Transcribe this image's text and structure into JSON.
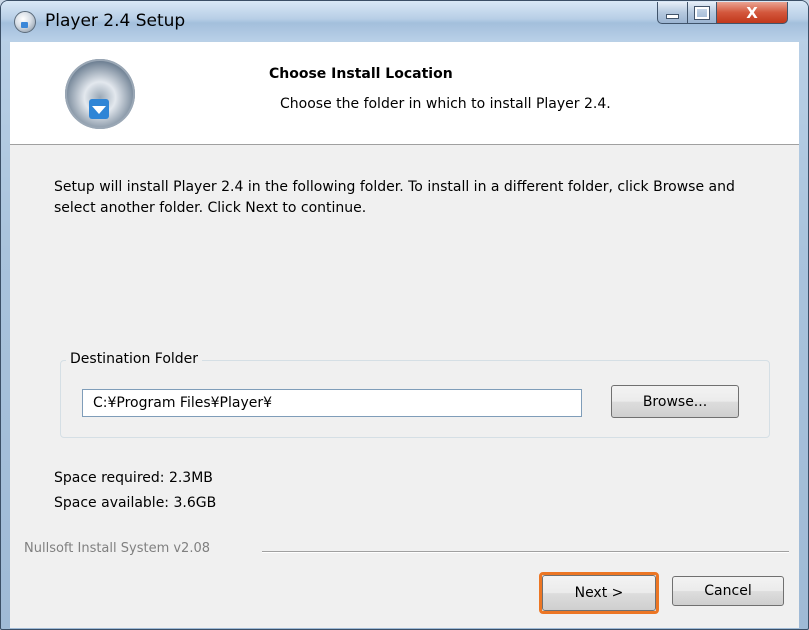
{
  "window": {
    "title": "Player 2.4 Setup",
    "close_glyph": "X"
  },
  "header": {
    "title": "Choose Install Location",
    "subtitle": "Choose the folder in which to install Player 2.4."
  },
  "main": {
    "intro": "Setup will install Player 2.4 in the following folder. To install in a different folder, click Browse and select another folder. Click Next to continue.",
    "destination_label": "Destination Folder",
    "destination_value": "C:¥Program Files¥Player¥",
    "browse_label": "Browse...",
    "space_required": "Space required: 2.3MB",
    "space_available": "Space available: 3.6GB"
  },
  "footer": {
    "branding": "Nullsoft Install System v2.08",
    "next_label": "Next >",
    "cancel_label": "Cancel"
  },
  "colors": {
    "highlight": "#ec7624",
    "close_button": "#c1371b"
  },
  "icons": {
    "app": "installer-disc-icon",
    "header": "install-disc-download-icon"
  }
}
